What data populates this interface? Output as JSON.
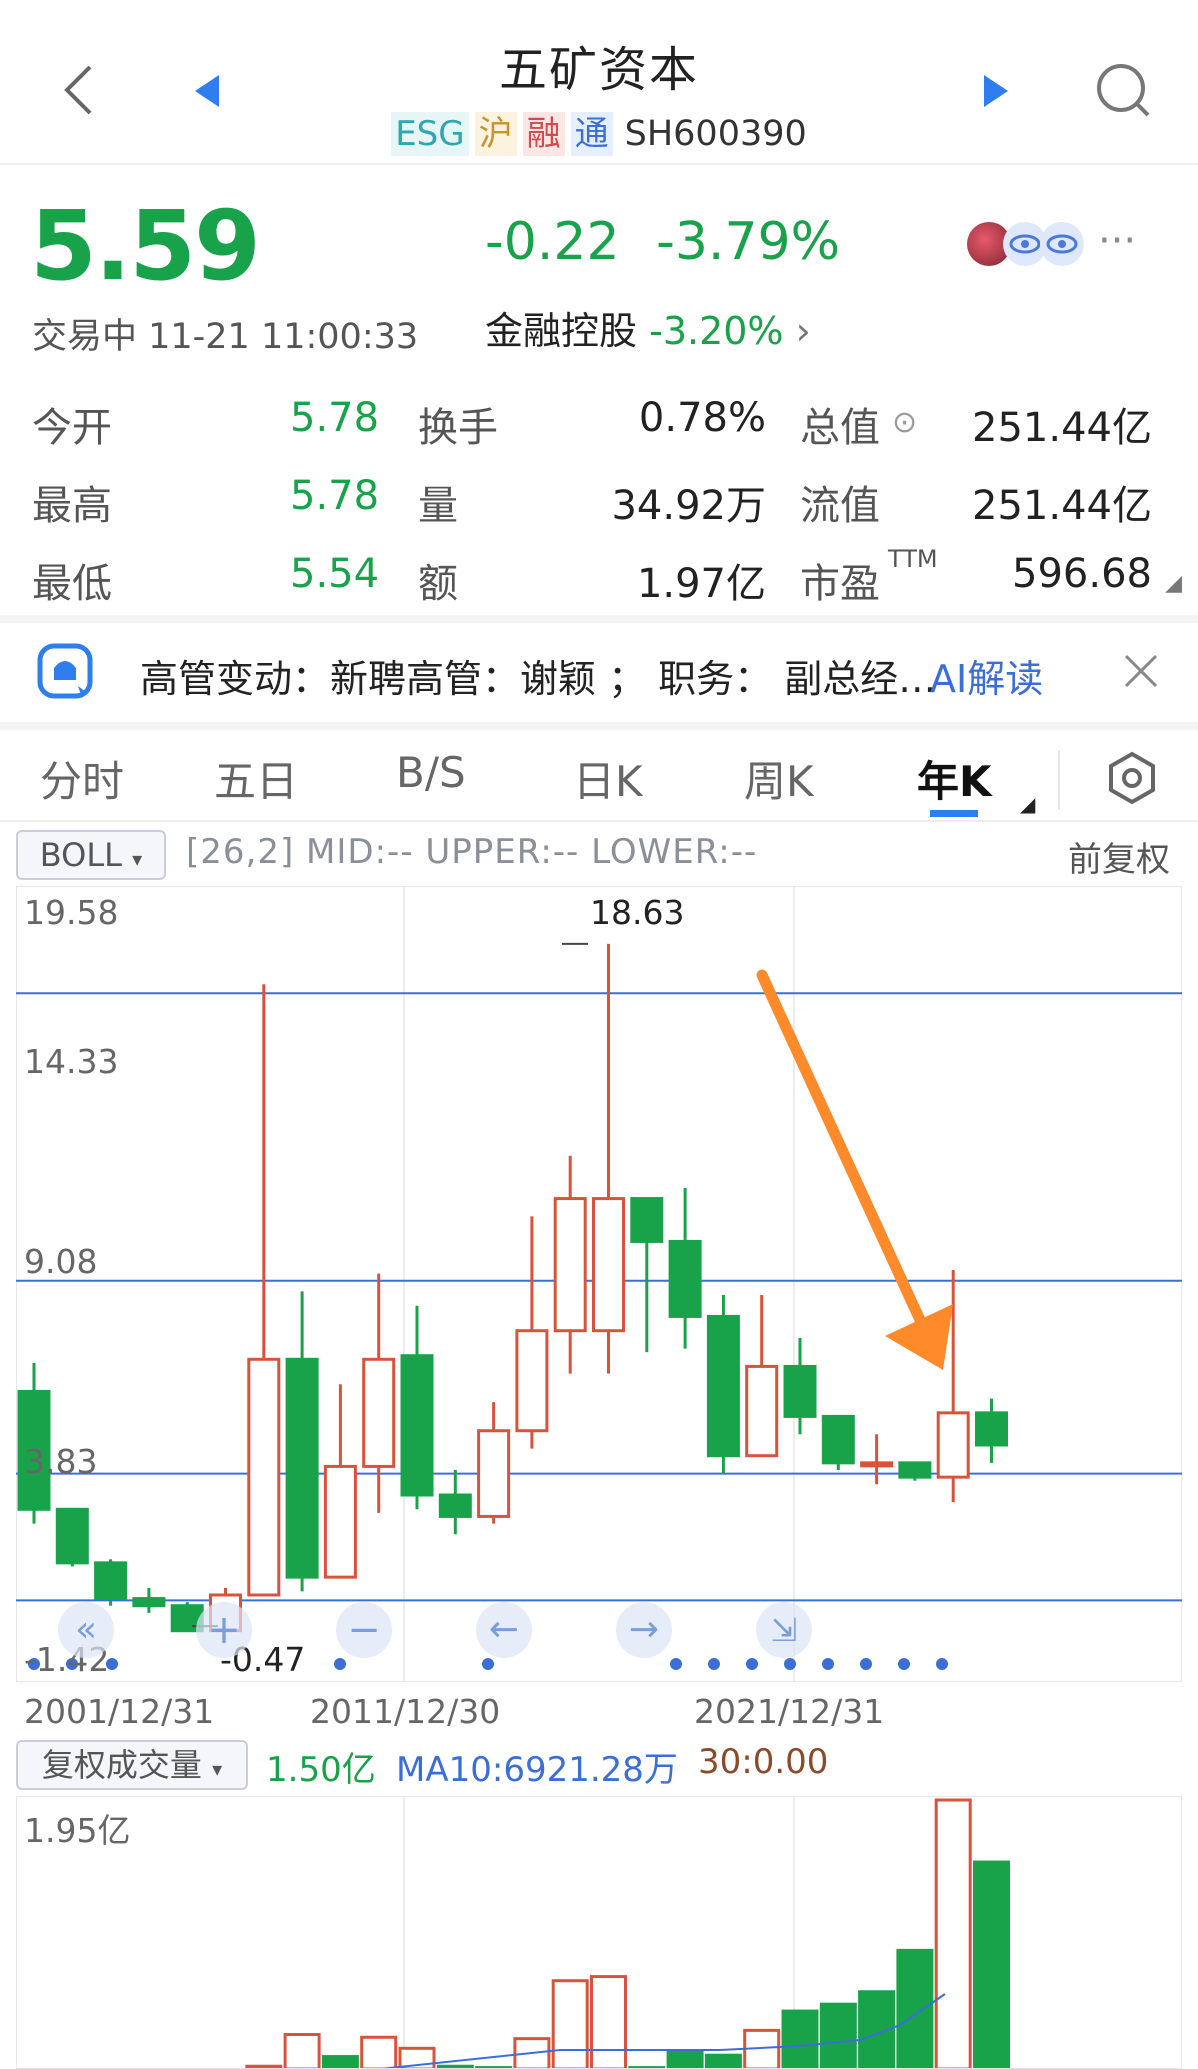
{
  "header": {
    "title": "五矿资本",
    "tags": [
      "ESG",
      "沪",
      "融",
      "通"
    ],
    "code": "SH600390"
  },
  "quote": {
    "price": "5.59",
    "change": "-0.22",
    "change_pct": "-3.79%",
    "status": "交易中 11-21 11:00:33",
    "sector_name": "金融控股",
    "sector_pct": "-3.20%",
    "more": "···"
  },
  "stats": {
    "open_label": "今开",
    "open_value": "5.78",
    "high_label": "最高",
    "high_value": "5.78",
    "low_label": "最低",
    "low_value": "5.54",
    "turnover_label": "换手",
    "turnover_value": "0.78%",
    "volume_label": "量",
    "volume_value": "34.92万",
    "amount_label": "额",
    "amount_value": "1.97亿",
    "mktcap_label": "总值",
    "mktcap_value": "251.44亿",
    "float_label": "流值",
    "float_value": "251.44亿",
    "pe_label": "市盈",
    "pe_sup": "TTM",
    "pe_value": "596.68"
  },
  "ai": {
    "text": "高管变动：新聘高管：谢颖 ； 职务： 副总经…",
    "link": "AI解读"
  },
  "tabs": [
    "分时",
    "五日",
    "B/S",
    "日K",
    "周K",
    "年K"
  ],
  "indicator": {
    "name": "BOLL",
    "params": "[26,2]  MID:--  UPPER:--  LOWER:--",
    "adjust": "前复权"
  },
  "chart_data": {
    "type": "candlestick",
    "y_ticks": [
      "19.58",
      "14.33",
      "9.08",
      "3.83",
      "-1.42"
    ],
    "ylim": [
      -1.42,
      19.58
    ],
    "x_ticks": [
      "2001/12/31",
      "2011/12/30",
      "2021/12/31"
    ],
    "max_label": "18.63",
    "min_label": "-0.47",
    "boll_lines": [
      17.25,
      9.2,
      3.8,
      0.25
    ],
    "candles": [
      {
        "o": 6.1,
        "c": 2.8,
        "h": 6.9,
        "l": 2.4
      },
      {
        "o": 2.8,
        "c": 1.3,
        "h": 2.8,
        "l": 1.2
      },
      {
        "o": 1.3,
        "c": 0.3,
        "h": 1.4,
        "l": 0.1
      },
      {
        "o": 0.3,
        "c": 0.1,
        "h": 0.6,
        "l": -0.1
      },
      {
        "o": 0.1,
        "c": -0.6,
        "h": 0.2,
        "l": -0.6
      },
      {
        "o": -0.6,
        "c": 0.4,
        "h": 0.6,
        "l": -0.6
      },
      {
        "o": 0.4,
        "c": 7.0,
        "h": 17.5,
        "l": 0.4
      },
      {
        "o": 7.0,
        "c": 0.9,
        "h": 8.9,
        "l": 0.5
      },
      {
        "o": 0.9,
        "c": 4.0,
        "h": 6.3,
        "l": 0.9
      },
      {
        "o": 4.0,
        "c": 7.0,
        "h": 9.4,
        "l": 2.7
      },
      {
        "o": 7.1,
        "c": 3.2,
        "h": 8.5,
        "l": 2.8
      },
      {
        "o": 3.2,
        "c": 2.6,
        "h": 3.9,
        "l": 2.1
      },
      {
        "o": 2.6,
        "c": 5.0,
        "h": 5.8,
        "l": 2.4
      },
      {
        "o": 5.0,
        "c": 7.8,
        "h": 11.0,
        "l": 4.5
      },
      {
        "o": 7.8,
        "c": 11.5,
        "h": 12.7,
        "l": 6.6
      },
      {
        "o": 7.8,
        "c": 11.5,
        "h": 18.63,
        "l": 6.6
      },
      {
        "o": 11.5,
        "c": 10.3,
        "h": 11.4,
        "l": 7.2
      },
      {
        "o": 10.3,
        "c": 8.2,
        "h": 11.8,
        "l": 7.3
      },
      {
        "o": 8.2,
        "c": 4.3,
        "h": 8.8,
        "l": 3.8
      },
      {
        "o": 4.3,
        "c": 6.8,
        "h": 8.8,
        "l": 4.3
      },
      {
        "o": 6.8,
        "c": 5.4,
        "h": 7.6,
        "l": 4.9
      },
      {
        "o": 5.4,
        "c": 4.1,
        "h": 5.4,
        "l": 3.9
      },
      {
        "o": 4.1,
        "c": 4.1,
        "h": 4.9,
        "l": 3.5
      },
      {
        "o": 4.1,
        "c": 3.7,
        "h": 4.1,
        "l": 3.6
      },
      {
        "o": 3.7,
        "c": 5.5,
        "h": 9.5,
        "l": 3.0
      },
      {
        "o": 5.5,
        "c": 4.6,
        "h": 5.9,
        "l": 4.1
      }
    ],
    "controls": [
      "«",
      "+",
      "−",
      "←",
      "→",
      "⇲"
    ]
  },
  "volume": {
    "btn": "复权成交量",
    "value": "1.50亿",
    "ma10": "MA10:6921.28万",
    "ma30": "30:0.00",
    "max_label": "1.95亿",
    "bars": [
      {
        "v": 0,
        "up": false
      },
      {
        "v": 0,
        "up": false
      },
      {
        "v": 0,
        "up": false
      },
      {
        "v": 0,
        "up": false
      },
      {
        "v": 0,
        "up": false
      },
      {
        "v": 0.02,
        "up": true
      },
      {
        "v": 0.25,
        "up": true
      },
      {
        "v": 0.09,
        "up": false
      },
      {
        "v": 0.23,
        "up": true
      },
      {
        "v": 0.15,
        "up": true
      },
      {
        "v": 0.02,
        "up": false
      },
      {
        "v": 0.01,
        "up": false
      },
      {
        "v": 0.22,
        "up": true
      },
      {
        "v": 0.64,
        "up": true
      },
      {
        "v": 0.67,
        "up": true
      },
      {
        "v": 0.01,
        "up": false
      },
      {
        "v": 0.13,
        "up": false
      },
      {
        "v": 0.1,
        "up": false
      },
      {
        "v": 0.28,
        "up": true
      },
      {
        "v": 0.42,
        "up": false
      },
      {
        "v": 0.47,
        "up": false
      },
      {
        "v": 0.56,
        "up": false
      },
      {
        "v": 0.86,
        "up": false
      },
      {
        "v": 1.95,
        "up": true
      },
      {
        "v": 1.5,
        "up": false
      }
    ]
  },
  "colors": {
    "up": "#d9533c",
    "down": "#18a24a",
    "boll": "#3b6fd6",
    "arrow": "#ff8a2a",
    "accent": "#3b6fd6"
  }
}
